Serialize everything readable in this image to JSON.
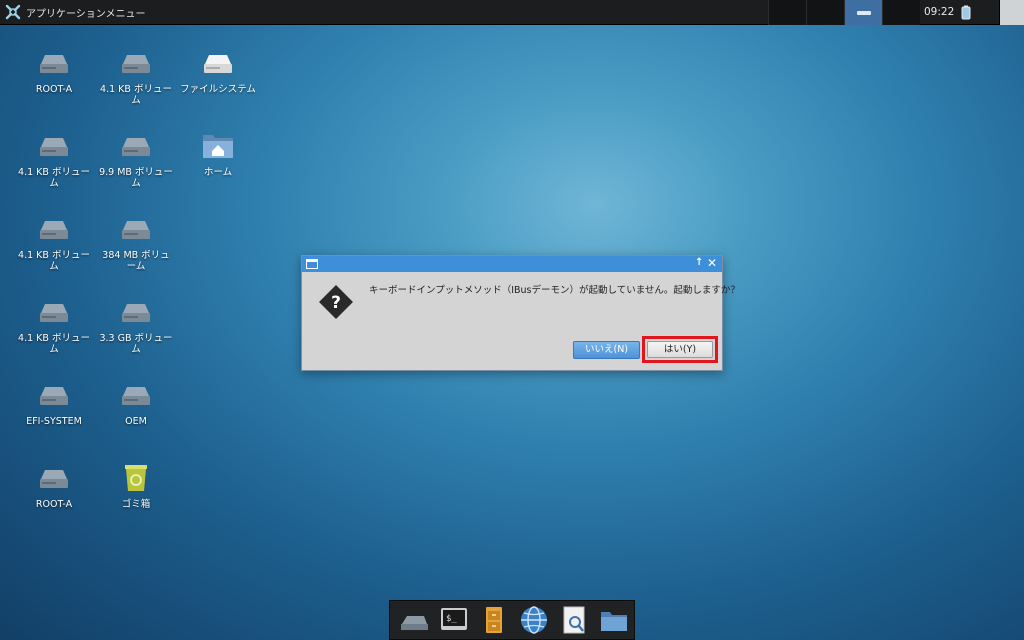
{
  "panel": {
    "app_menu_label": "アプリケーションメニュー",
    "clock": "09:22",
    "workspaces": 4,
    "active_workspace": 3
  },
  "desktop": {
    "icons": [
      {
        "label": "ROOT-A",
        "icon": "drive-icon"
      },
      {
        "label": "4.1 KB ボリューム",
        "icon": "drive-icon"
      },
      {
        "label": "ファイルシステム",
        "icon": "filesystem-drive-icon"
      },
      {
        "label": "4.1 KB ボリューム",
        "icon": "drive-icon"
      },
      {
        "label": "9.9 MB ボリューム",
        "icon": "drive-icon"
      },
      {
        "label": "ホーム",
        "icon": "home-folder-icon"
      },
      {
        "label": "4.1 KB ボリューム",
        "icon": "drive-icon"
      },
      {
        "label": "384 MB ボリューム",
        "icon": "drive-icon"
      },
      {
        "label": "4.1 KB ボリューム",
        "icon": "drive-icon"
      },
      {
        "label": "3.3 GB ボリューム",
        "icon": "drive-icon"
      },
      {
        "label": "EFI-SYSTEM",
        "icon": "drive-icon"
      },
      {
        "label": "OEM",
        "icon": "drive-icon"
      },
      {
        "label": "ROOT-A",
        "icon": "drive-icon"
      },
      {
        "label": "ゴミ箱",
        "icon": "trash-icon"
      }
    ]
  },
  "dialog": {
    "message": "キーボードインプットメソッド（IBusデーモン）が起動していません。起動しますか？",
    "no_label": "いいえ(N)",
    "yes_label": "はい(Y)",
    "icon": "question-icon"
  },
  "dock": {
    "items": [
      "drive-icon",
      "terminal-icon",
      "file-cabinet-icon",
      "web-browser-icon",
      "search-document-icon",
      "folder-icon"
    ]
  },
  "colors": {
    "panel_bg": "#1b1d1f",
    "dialog_titlebar": "#3e8fd9",
    "highlight": "#e0161f"
  }
}
